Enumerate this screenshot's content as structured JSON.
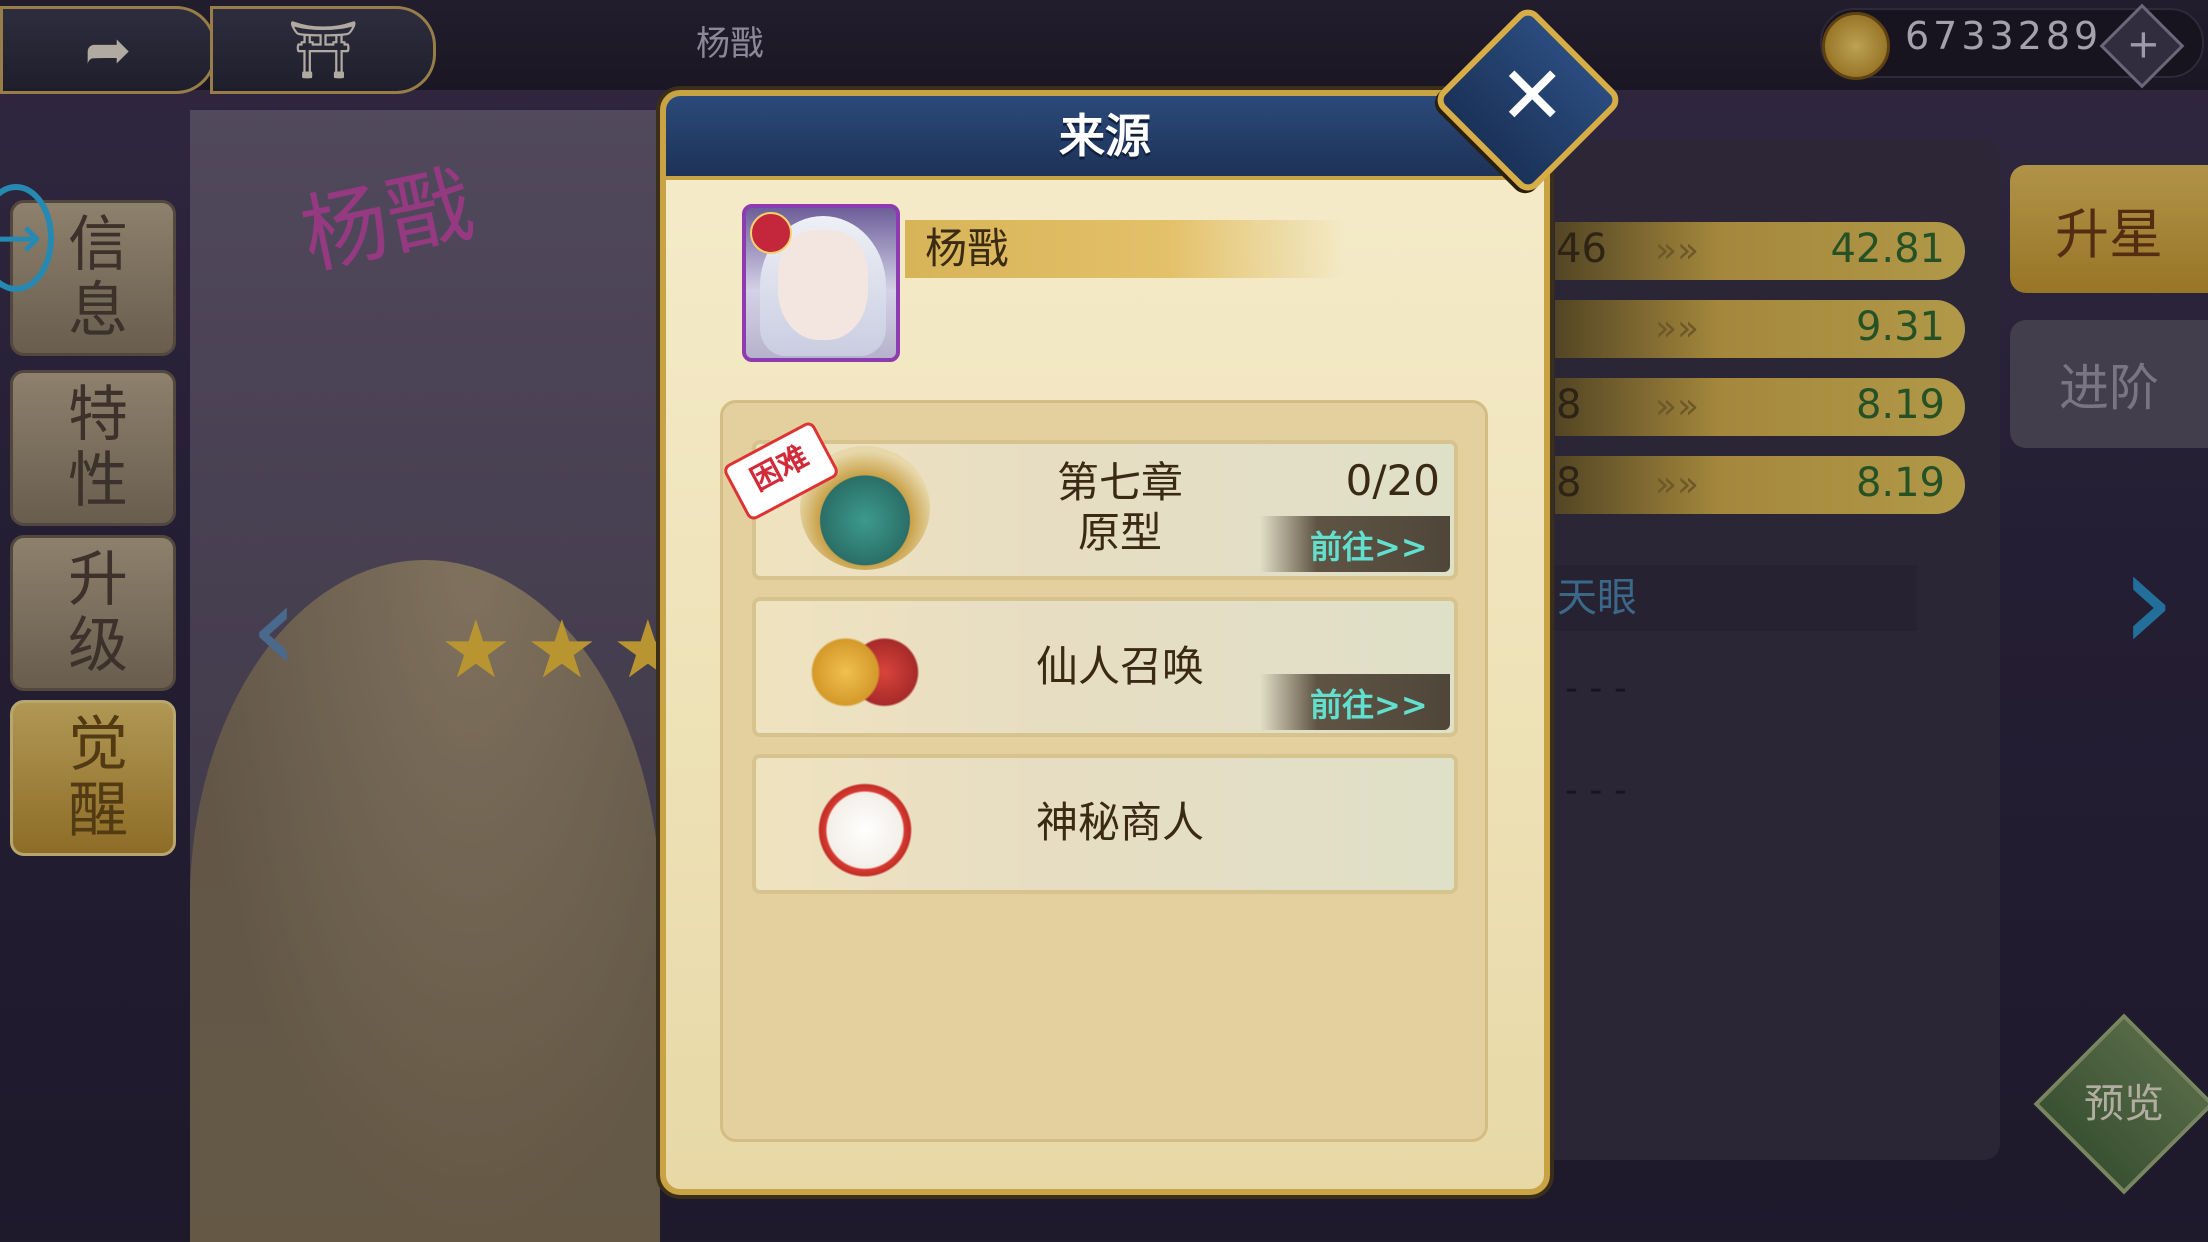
{
  "top_bar": {
    "hero_title": "杨戬",
    "currency_value": "6733289",
    "add_label": "+"
  },
  "side_menu": [
    {
      "label": "信息",
      "active": false
    },
    {
      "label": "特性",
      "active": false
    },
    {
      "label": "升级",
      "active": false
    },
    {
      "label": "觉醒",
      "active": true
    }
  ],
  "scene": {
    "hero_art_text": "杨戬",
    "stars_shown": 3
  },
  "stats_panel": {
    "rows": [
      {
        "left": "46",
        "value": "42.81"
      },
      {
        "left": "",
        "value": "9.31"
      },
      {
        "left": "8",
        "value": "8.19"
      },
      {
        "left": "8",
        "value": "8.19"
      }
    ],
    "skill": "天眼",
    "dashes": [
      "- - -",
      "- - -"
    ],
    "tab_star": "升星",
    "tab_advance": "进阶",
    "preview": "预览"
  },
  "dialog": {
    "title": "来源",
    "close": "✕",
    "hero_name": "杨戬",
    "sources": [
      {
        "tag": "困难",
        "label_line1": "第七章",
        "label_line2": "原型",
        "progress": "0/20",
        "go": "前往>>",
        "icon": "palace-icon"
      },
      {
        "label": "仙人召唤",
        "go": "前往>>",
        "icon": "immortal-summon-icon"
      },
      {
        "label": "神秘商人",
        "icon": "lucky-cat-icon"
      }
    ]
  }
}
